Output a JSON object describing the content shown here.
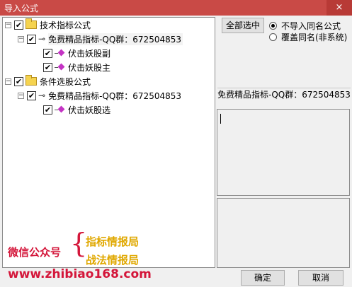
{
  "window": {
    "title": "导入公式",
    "close_glyph": "×"
  },
  "tree": {
    "groups": [
      {
        "label": "技术指标公式",
        "source": "免费精品指标-QQ群：672504853",
        "items": [
          "伏击妖股副",
          "伏击妖股主"
        ]
      },
      {
        "label": "条件选股公式",
        "source": "免费精品指标-QQ群：672504853",
        "items": [
          "伏击妖股选"
        ]
      }
    ],
    "check_glyph": "✔",
    "collapse_glyph": "−"
  },
  "promo": {
    "wechat_label": "微信公众号",
    "brace": "{",
    "name1": "指标情报局",
    "name2": "战法情报局",
    "url": "www.zhibiao168.com"
  },
  "controls": {
    "select_all": "全部选中",
    "radio_skip": "不导入同名公式",
    "radio_overwrite": "覆盖同名(非系统)",
    "info_label": "免费精品指标-QQ群：672504853",
    "ok": "确定",
    "cancel": "取消"
  },
  "colors": {
    "title_bar": "#c94a46",
    "promo_red": "#d4163a",
    "promo_gold": "#e0a800"
  }
}
